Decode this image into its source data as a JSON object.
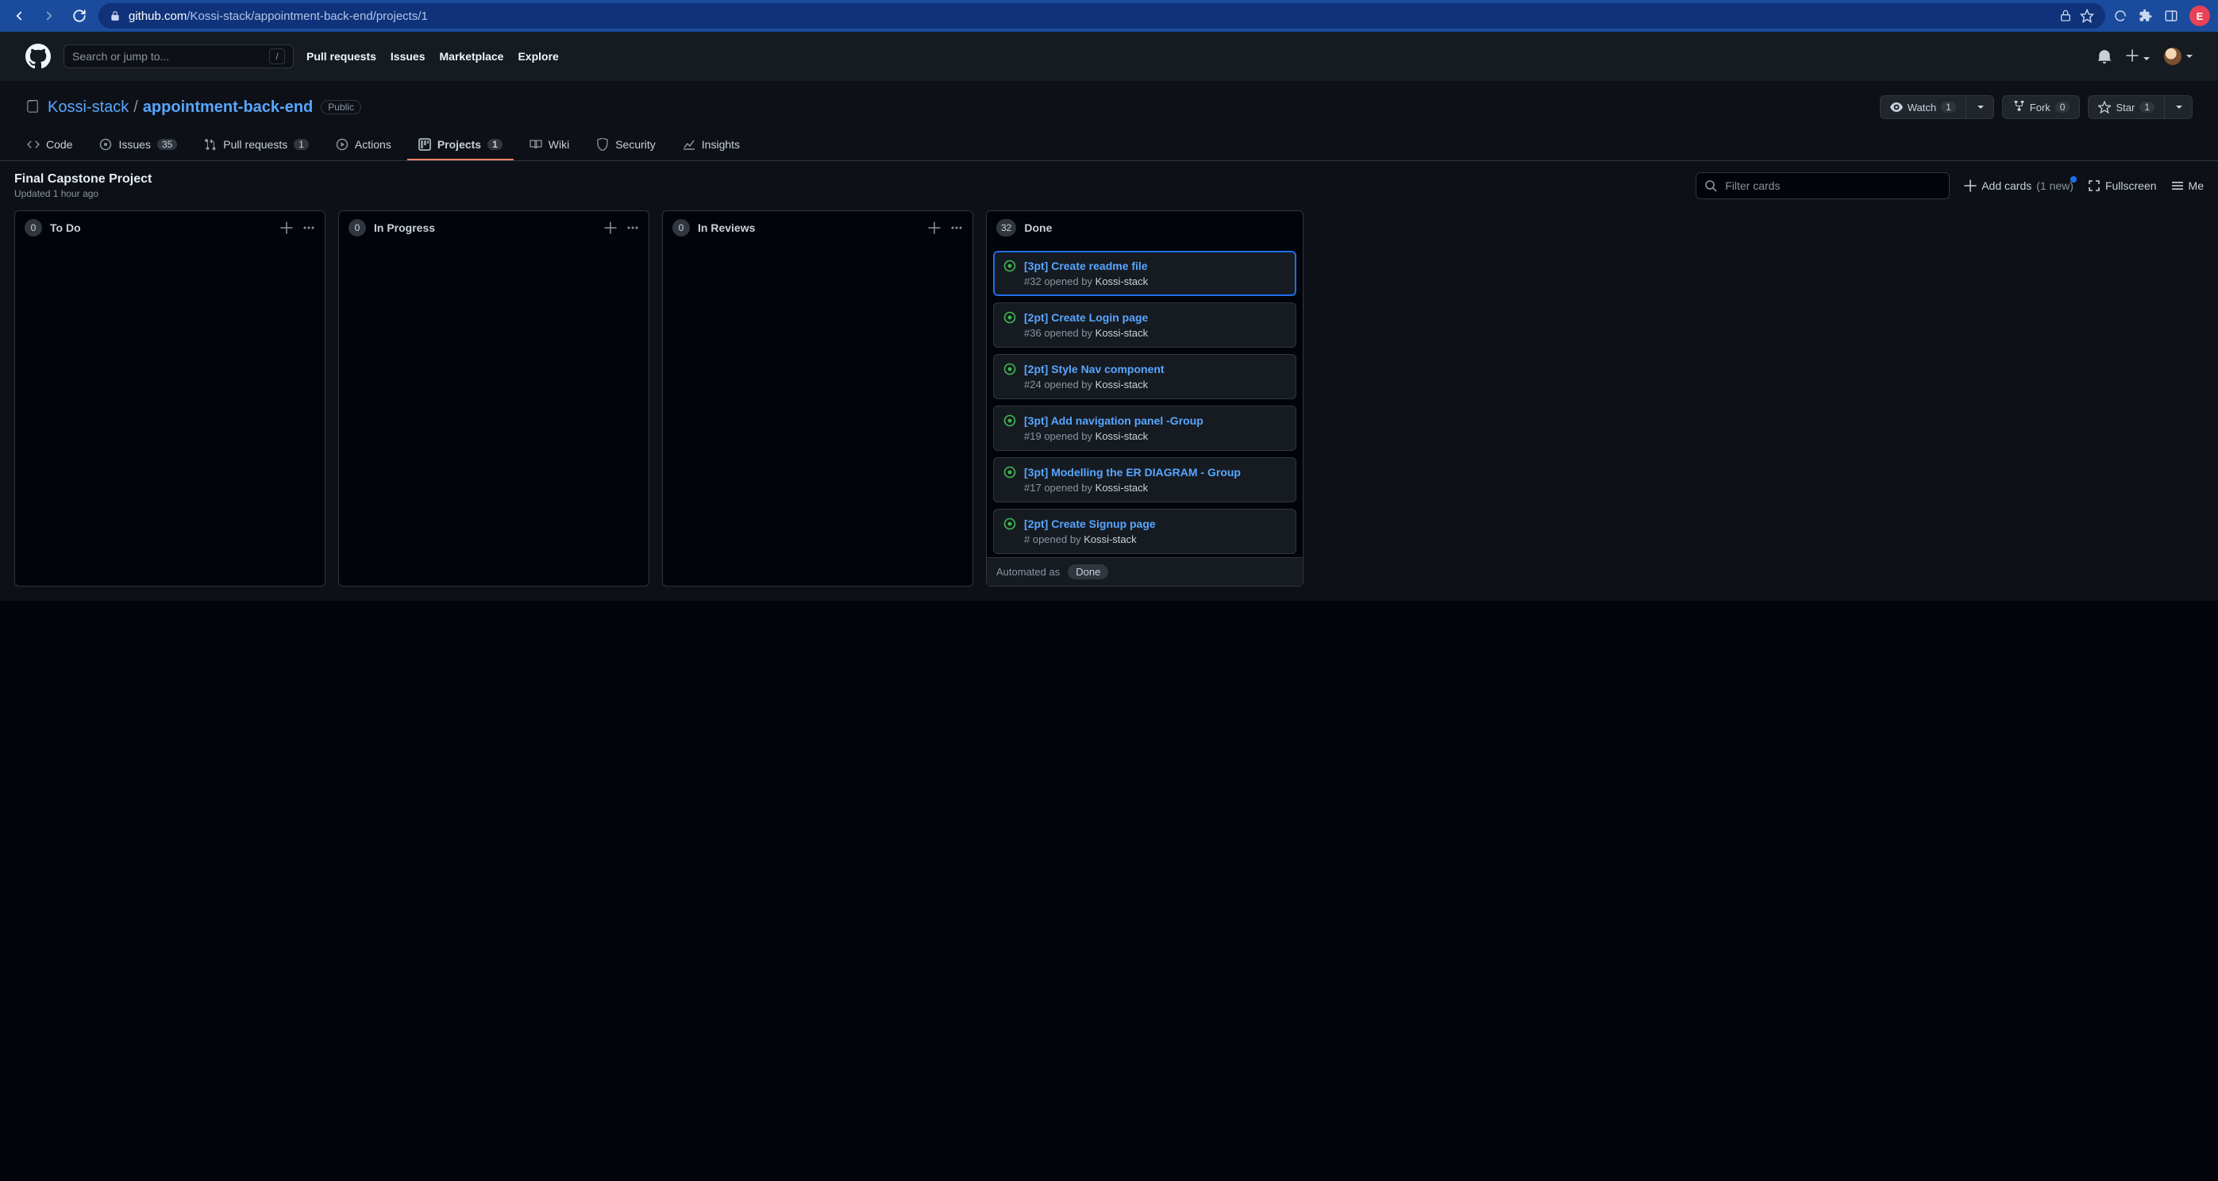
{
  "browser": {
    "url_host": "github.com",
    "url_path": "/Kossi-stack/appointment-back-end/projects/1",
    "avatar_letter": "E"
  },
  "gh_header": {
    "search_placeholder": "Search or jump to...",
    "slash": "/",
    "nav": {
      "pulls": "Pull requests",
      "issues": "Issues",
      "marketplace": "Marketplace",
      "explore": "Explore"
    }
  },
  "repo": {
    "owner": "Kossi-stack",
    "name": "appointment-back-end",
    "visibility": "Public",
    "watch_label": "Watch",
    "watch_count": "1",
    "fork_label": "Fork",
    "fork_count": "0",
    "star_label": "Star",
    "star_count": "1"
  },
  "tabs": {
    "code": "Code",
    "issues": "Issues",
    "issues_count": "35",
    "pulls": "Pull requests",
    "pulls_count": "1",
    "actions": "Actions",
    "projects": "Projects",
    "projects_count": "1",
    "wiki": "Wiki",
    "security": "Security",
    "insights": "Insights"
  },
  "project": {
    "title": "Final Capstone Project",
    "updated": "Updated 1 hour ago",
    "filter_placeholder": "Filter cards",
    "add_cards": "Add cards",
    "add_cards_suffix": "(1 new)",
    "fullscreen": "Fullscreen",
    "menu": "Me",
    "automated_label": "Automated as",
    "automated_value": "Done"
  },
  "columns": [
    {
      "count": "0",
      "title": "To Do"
    },
    {
      "count": "0",
      "title": "In Progress"
    },
    {
      "count": "0",
      "title": "In Reviews"
    },
    {
      "count": "32",
      "title": "Done"
    }
  ],
  "done_cards": [
    {
      "title": "[3pt] Create readme file",
      "num": "#32",
      "author": "Kossi-stack",
      "selected": true
    },
    {
      "title": "[2pt] Create Login page",
      "num": "#36",
      "author": "Kossi-stack",
      "selected": false
    },
    {
      "title": "[2pt] Style Nav component",
      "num": "#24",
      "author": "Kossi-stack",
      "selected": false
    },
    {
      "title": "[3pt] Add navigation panel -Group",
      "num": "#19",
      "author": "Kossi-stack",
      "selected": false
    },
    {
      "title": "[3pt] Modelling the ER DIAGRAM - Group",
      "num": "#17",
      "author": "Kossi-stack",
      "selected": false
    },
    {
      "title": "[2pt] Create Signup page",
      "num": "#",
      "author": "Kossi-stack",
      "selected": false
    }
  ],
  "card_sub_opened_by": "opened by"
}
